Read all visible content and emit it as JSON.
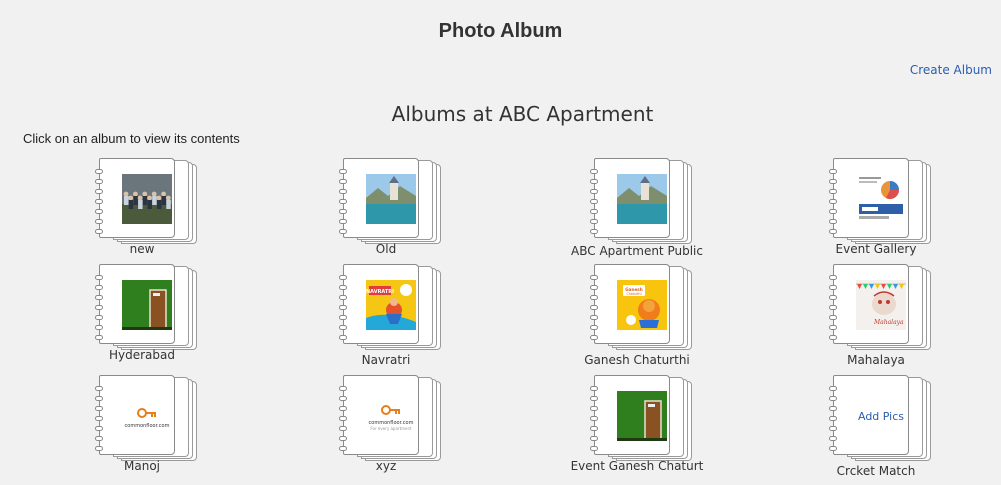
{
  "page": {
    "title": "Photo Album",
    "create_album_link": "Create Album",
    "section_title": "Albums at ABC Apartment",
    "instructions": "Click on an album to view its contents"
  },
  "albums": [
    {
      "title": "new",
      "thumbnail": "group-photo"
    },
    {
      "title": "Old",
      "thumbnail": "lake-castle-photo"
    },
    {
      "title": "ABC Apartment Public",
      "thumbnail": "lake-castle-photo"
    },
    {
      "title": "Event Gallery",
      "thumbnail": "infographic-image"
    },
    {
      "title": "Hyderabad",
      "thumbnail": "green-wall-door-photo"
    },
    {
      "title": "Navratri",
      "thumbnail": "happy-navratri-poster"
    },
    {
      "title": "Ganesh Chaturthi",
      "thumbnail": "ganesh-chaturthi-poster"
    },
    {
      "title": "Mahalaya",
      "thumbnail": "mahalaya-poster"
    },
    {
      "title": "Manoj",
      "thumbnail": "commonfloor-card",
      "logo_text": "commonfloor.com"
    },
    {
      "title": "xyz",
      "thumbnail": "commonfloor-logo",
      "logo_text": "commonfloor.com",
      "logo_tagline": "For every apartment"
    },
    {
      "title": "Event Ganesh Chaturt",
      "thumbnail": "green-wall-door-photo"
    },
    {
      "title": "Crcket Match",
      "thumbnail": "none",
      "add_pics_label": "Add Pics"
    }
  ],
  "thumbnail_text": {
    "navratri": "HAPPY NAVRATRI",
    "ganesh": "Ganesh Chaturthi"
  },
  "colors": {
    "background": "#f1f1f1",
    "link": "#2a5db0",
    "text": "#333333"
  }
}
